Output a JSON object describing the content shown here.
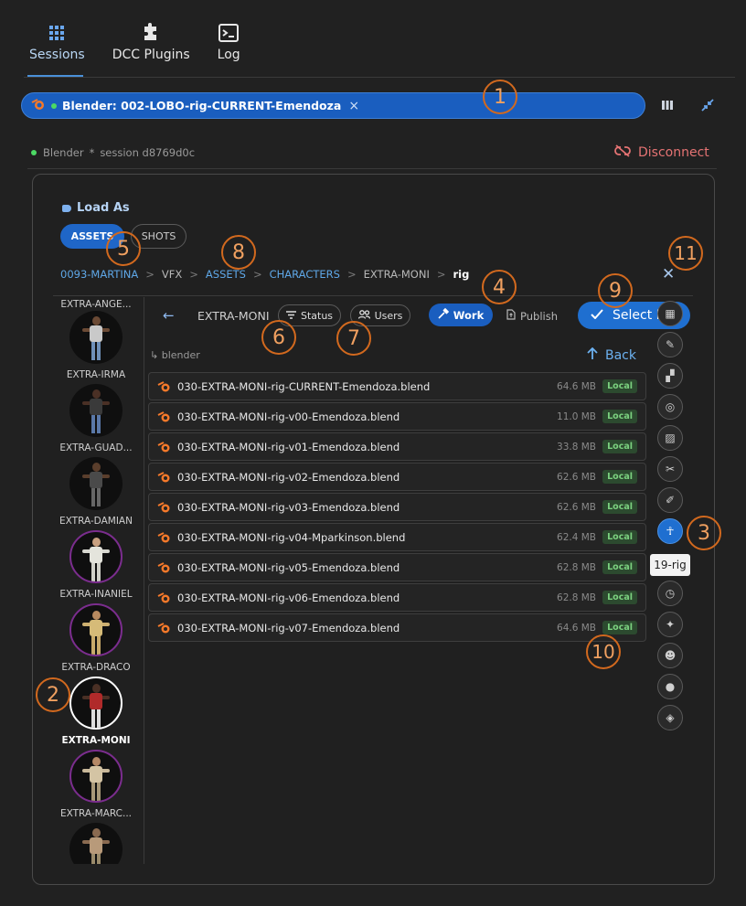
{
  "nav": {
    "tabs": [
      {
        "label": "Sessions",
        "icon": "grid-icon",
        "active": true
      },
      {
        "label": "DCC Plugins",
        "icon": "puzzle-icon",
        "active": false
      },
      {
        "label": "Log",
        "icon": "terminal-icon",
        "active": false
      }
    ]
  },
  "session": {
    "pill_label": "Blender: 002-LOBO-rig-CURRENT-Emendoza",
    "close": "×",
    "status_app": "Blender",
    "status_sep": "*",
    "status_session": "session d8769d0c",
    "disconnect_label": "Disconnect"
  },
  "panel": {
    "load_as": "Load As",
    "toggle_assets": "ASSETS",
    "toggle_shots": "SHOTS",
    "breadcrumb": {
      "items": [
        "0093-MARTINA",
        "VFX",
        "ASSETS",
        "CHARACTERS",
        "EXTRA-MONI"
      ],
      "current": "rig",
      "sep": ">"
    },
    "close": "✕"
  },
  "avatars": [
    {
      "label": "EXTRA-ANGE...",
      "style": "plain"
    },
    {
      "label": "EXTRA-IRMA",
      "style": "plain"
    },
    {
      "label": "EXTRA-GUAD...",
      "style": "plain"
    },
    {
      "label": "EXTRA-DAMIAN",
      "style": "plain"
    },
    {
      "label": "EXTRA-INANIEL",
      "style": "purple"
    },
    {
      "label": "EXTRA-DRACO",
      "style": "purple"
    },
    {
      "label": "EXTRA-MONI",
      "style": "selected"
    },
    {
      "label": "EXTRA-MARC...",
      "style": "purple"
    },
    {
      "label": "",
      "style": "plain"
    }
  ],
  "browser": {
    "title": "EXTRA-MONI",
    "status_chip": "Status",
    "users_chip": "Users",
    "work_label": "Work",
    "publish_label": "Publish",
    "select_label": "Select File",
    "path": "↳ blender",
    "back_label": "Back",
    "files": [
      {
        "name": "030-EXTRA-MONI-rig-CURRENT-Emendoza.blend",
        "size": "64.6 MB",
        "badge": "Local"
      },
      {
        "name": "030-EXTRA-MONI-rig-v00-Emendoza.blend",
        "size": "11.0 MB",
        "badge": "Local"
      },
      {
        "name": "030-EXTRA-MONI-rig-v01-Emendoza.blend",
        "size": "33.8 MB",
        "badge": "Local"
      },
      {
        "name": "030-EXTRA-MONI-rig-v02-Emendoza.blend",
        "size": "62.6 MB",
        "badge": "Local"
      },
      {
        "name": "030-EXTRA-MONI-rig-v03-Emendoza.blend",
        "size": "62.6 MB",
        "badge": "Local"
      },
      {
        "name": "030-EXTRA-MONI-rig-v04-Mparkinson.blend",
        "size": "62.4 MB",
        "badge": "Local"
      },
      {
        "name": "030-EXTRA-MONI-rig-v05-Emendoza.blend",
        "size": "62.8 MB",
        "badge": "Local"
      },
      {
        "name": "030-EXTRA-MONI-rig-v06-Emendoza.blend",
        "size": "62.8 MB",
        "badge": "Local"
      },
      {
        "name": "030-EXTRA-MONI-rig-v07-Emendoza.blend",
        "size": "64.6 MB",
        "badge": "Local"
      }
    ]
  },
  "tasks": {
    "tooltip": "19-rig",
    "icons": [
      "grid-icon",
      "brush-icon",
      "blocks-icon",
      "camera-focus-icon",
      "hatch-icon",
      "tools-icon",
      "paint-icon",
      "rig-person-icon",
      "timer-icon",
      "sparkle-icon",
      "robot-icon",
      "bulb-icon",
      "layers-icon"
    ]
  },
  "annotations": [
    "1",
    "2",
    "3",
    "4",
    "5",
    "6",
    "7",
    "8",
    "9",
    "10",
    "11"
  ]
}
